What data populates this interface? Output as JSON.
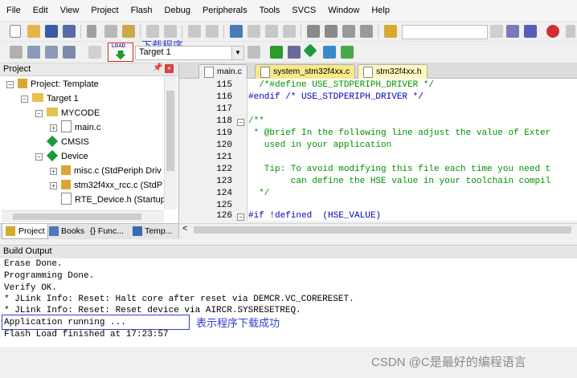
{
  "menu": [
    "File",
    "Edit",
    "View",
    "Project",
    "Flash",
    "Debug",
    "Peripherals",
    "Tools",
    "SVCS",
    "Window",
    "Help"
  ],
  "toolbar": {
    "target_select": "Target 1",
    "load_icon_text": "LOAD",
    "load_annotation": "下载程序"
  },
  "project": {
    "title": "Project",
    "tree": [
      {
        "label": "Project: Template"
      },
      {
        "label": "Target 1"
      },
      {
        "label": "MYCODE"
      },
      {
        "label": "main.c"
      },
      {
        "label": "CMSIS"
      },
      {
        "label": "Device"
      },
      {
        "label": "misc.c (StdPeriph Driv"
      },
      {
        "label": "stm32f4xx_rcc.c (StdP"
      },
      {
        "label": "RTE_Device.h (Startup"
      }
    ],
    "bottom_tabs": [
      "Project",
      "Books",
      "{} Func...",
      "Temp..."
    ]
  },
  "editor": {
    "tabs": [
      "main.c",
      "system_stm32f4xx.c",
      "stm32f4xx.h"
    ],
    "lines": [
      {
        "n": "115",
        "t": "  /*#define USE_STDPERIPH_DRIVER */"
      },
      {
        "n": "116",
        "t": "#endif /* USE_STDPERIPH_DRIVER */"
      },
      {
        "n": "117",
        "t": ""
      },
      {
        "n": "118",
        "t": "/**"
      },
      {
        "n": "119",
        "t": " * @brief In the following line adjust the value of Exter"
      },
      {
        "n": "120",
        "t": "   used in your application"
      },
      {
        "n": "121",
        "t": ""
      },
      {
        "n": "122",
        "t": "   Tip: To avoid modifying this file each time you need t"
      },
      {
        "n": "123",
        "t": "        can define the HSE value in your toolchain compil"
      },
      {
        "n": "124",
        "t": "  */"
      },
      {
        "n": "125",
        "t": ""
      },
      {
        "n": "126",
        "t": "#if !defined  (HSE_VALUE)"
      }
    ]
  },
  "build_output": {
    "title": "Build Output",
    "lines": [
      "Erase Done.",
      "Programming Done.",
      "Verify OK.",
      "* JLink Info: Reset: Halt core after reset via DEMCR.VC_CORERESET.",
      "* JLink Info: Reset: Reset device via AIRCR.SYSRESETREQ.",
      "Application running ...",
      "Flash Load finished at 17:23:57"
    ],
    "success_annotation": "表示程序下载成功"
  },
  "watermark": "CSDN @C是最好的编程语言",
  "colors": {
    "annotation_red": "#e02020",
    "annotation_blue": "#3040d0",
    "comment_green": "#009000",
    "directive_blue": "#0000c0"
  }
}
